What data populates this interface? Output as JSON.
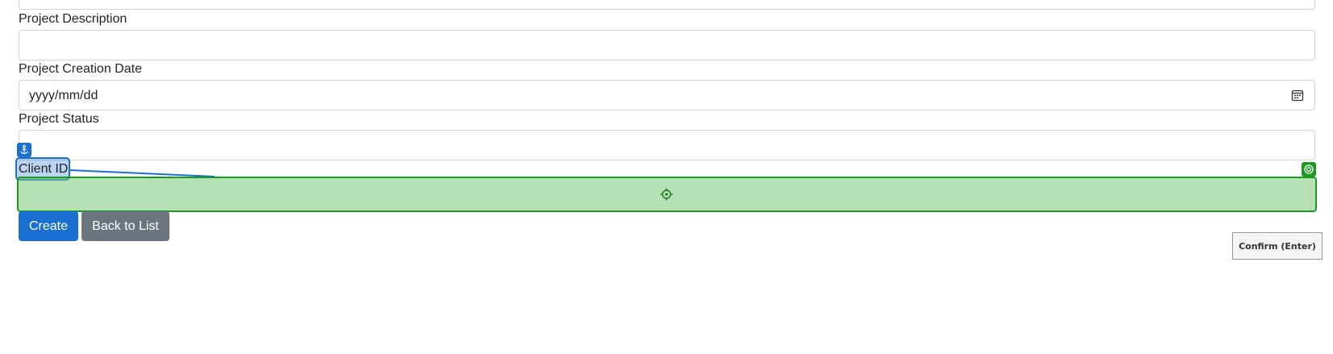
{
  "form": {
    "description_label": "Project Description",
    "description_value": "",
    "creation_date_label": "Project Creation Date",
    "creation_date_placeholder": "yyyy/mm/dd",
    "status_label": "Project Status",
    "status_value": "",
    "client_id_label": "Client ID",
    "client_id_value": ""
  },
  "buttons": {
    "create": "Create",
    "back": "Back to List"
  },
  "overlay": {
    "confirm_label": "Confirm (Enter)",
    "source_color": "#1a6fd1",
    "target_color": "#1a9a22"
  },
  "colors": {
    "primary": "#1a6fd1",
    "secondary": "#6c757d",
    "border": "#ced4da"
  }
}
